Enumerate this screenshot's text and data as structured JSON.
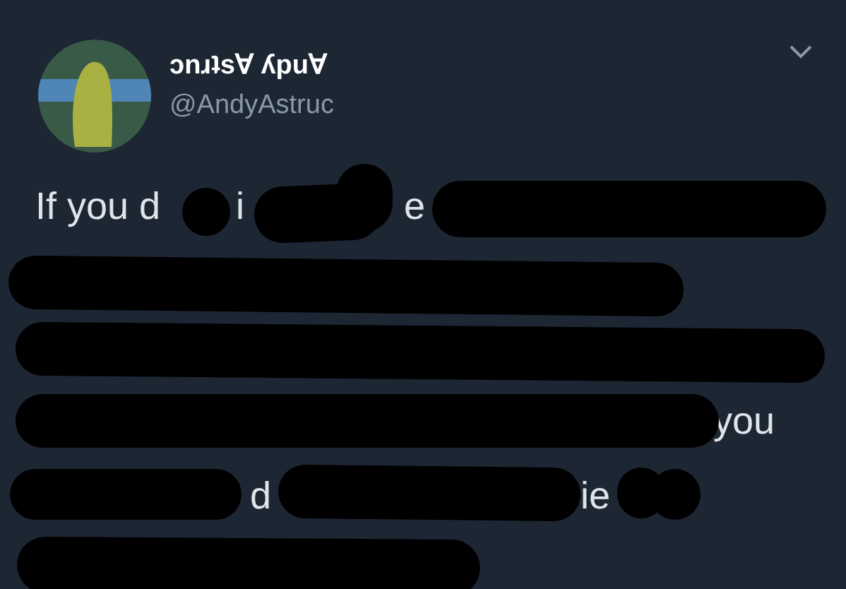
{
  "tweet": {
    "display_name": "ɔnɹʇs∀ ʎpu∀",
    "handle": "@AndyAstruc",
    "visible_text": [
      [
        "If you d",
        "i",
        "e"
      ],
      [
        "you"
      ],
      [
        "d",
        "ie"
      ]
    ]
  }
}
